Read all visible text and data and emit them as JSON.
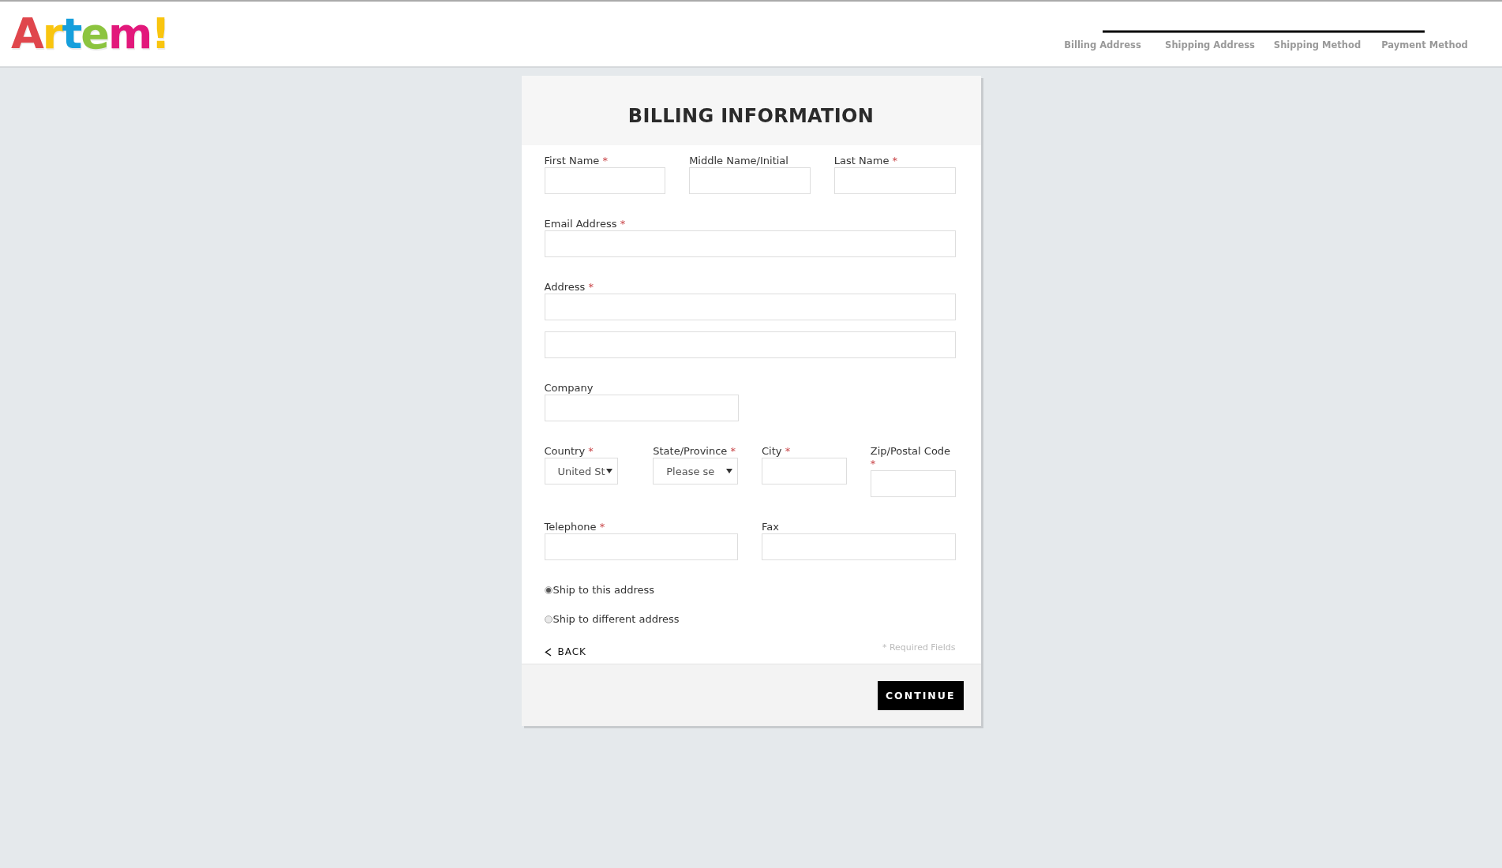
{
  "logo": {
    "letters": [
      {
        "char": "A",
        "color": "#e0464c"
      },
      {
        "char": "r",
        "color": "#f9c50f"
      },
      {
        "char": "t",
        "color": "#159fdc"
      },
      {
        "char": "e",
        "color": "#8cc43f"
      },
      {
        "char": "m",
        "color": "#e2187b"
      },
      {
        "char": "!",
        "color": "#f9c50f"
      }
    ]
  },
  "steps": [
    {
      "label": "Billing Address"
    },
    {
      "label": "Shipping Address"
    },
    {
      "label": "Shipping Method"
    },
    {
      "label": "Payment Method"
    }
  ],
  "form": {
    "title": "BILLING INFORMATION",
    "rows": [
      {
        "fields": [
          {
            "kind": "text",
            "label": "First Name",
            "required_mark": "*"
          },
          {
            "kind": "text",
            "label": "Middle Name/Initial"
          },
          {
            "kind": "text",
            "label": "Last Name",
            "required_mark": "*"
          }
        ]
      },
      {
        "fields": [
          {
            "kind": "text",
            "label": "Email Address",
            "required_mark": "*"
          }
        ]
      },
      {
        "fields": [
          {
            "kind": "double",
            "label": "Address",
            "required_mark": "*"
          }
        ]
      },
      {
        "fields": [
          {
            "kind": "short",
            "label": "Company"
          }
        ]
      },
      {
        "fields": [
          {
            "kind": "select",
            "label": "Country",
            "required_mark": "*",
            "value": "United St"
          },
          {
            "kind": "select",
            "label": "State/Province",
            "required_mark": "*",
            "value": "Please se"
          },
          {
            "kind": "text",
            "label": "City",
            "required_mark": "*"
          },
          {
            "kind": "text",
            "label": "Zip/Postal Code",
            "required_mark": "*"
          }
        ]
      },
      {
        "fields": [
          {
            "kind": "text",
            "label": "Telephone",
            "required_mark": "*"
          },
          {
            "kind": "text",
            "label": "Fax"
          }
        ]
      }
    ],
    "shipping_options": [
      {
        "label": "Ship to this address",
        "selected": true
      },
      {
        "label": "Ship to different address",
        "selected": false
      }
    ],
    "back": "BACK",
    "required_note": "* Required Fields",
    "continue": "CONTINUE"
  }
}
